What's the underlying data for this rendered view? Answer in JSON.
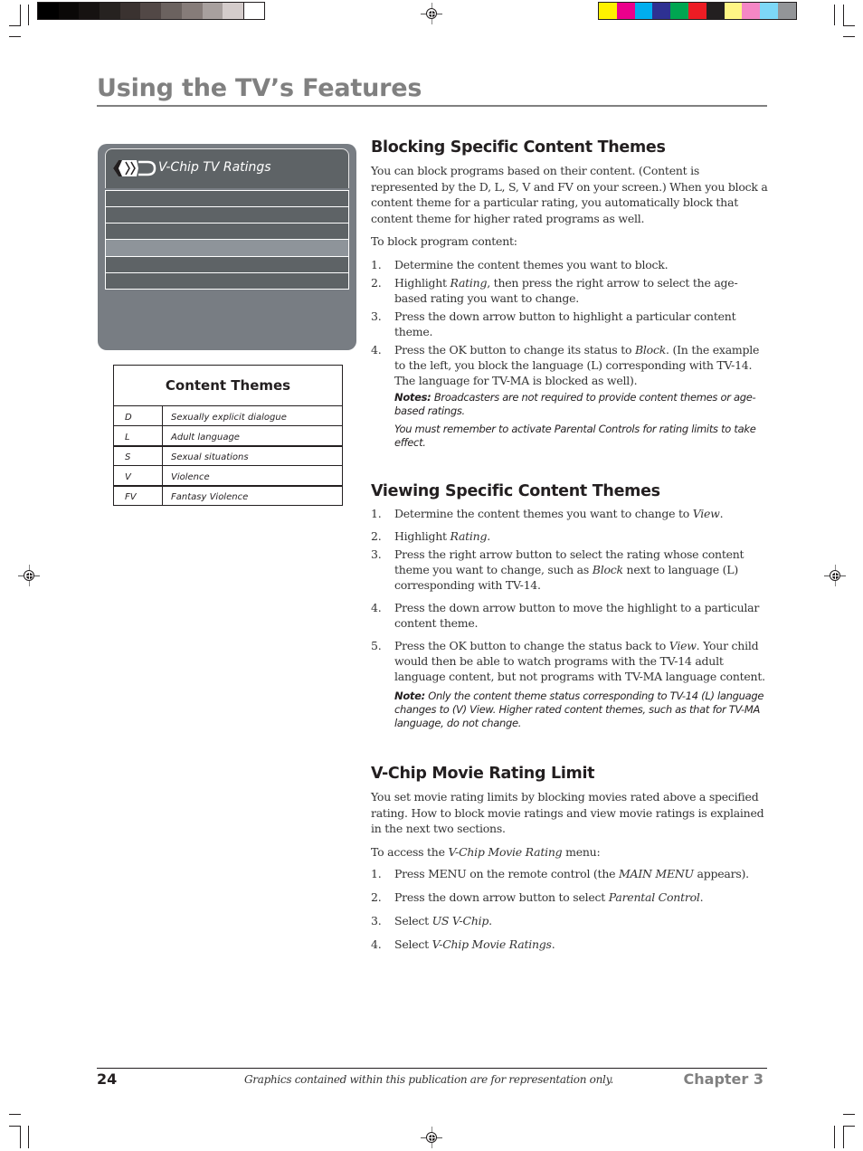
{
  "print_marks": {
    "grayscale_bars": [
      "#000000",
      "#0a0807",
      "#161211",
      "#262220",
      "#3a3230",
      "#524846",
      "#6b625f",
      "#867c79",
      "#a8a09e",
      "#d4cccb",
      "#ffffff"
    ],
    "color_bars": [
      "#fff200",
      "#ec008c",
      "#00aeef",
      "#2e3192",
      "#00a651",
      "#ed1c24",
      "#231f20",
      "#fff685",
      "#f587c5",
      "#7dd8f7",
      "#939598"
    ]
  },
  "header": {
    "title": "Using the TV’s Features"
  },
  "tv_menu": {
    "logo_icon": "v-chip-logo",
    "title": "V-Chip TV Ratings",
    "rows": [
      {
        "highlighted": false
      },
      {
        "highlighted": false
      },
      {
        "highlighted": false
      },
      {
        "highlighted": true
      },
      {
        "highlighted": false
      },
      {
        "highlighted": false
      }
    ],
    "colors": {
      "panel": "#787d83",
      "row": "#5e6366",
      "row_highlight": "#8e949a"
    }
  },
  "content_themes": {
    "title": "Content Themes",
    "rows": [
      {
        "code": "D",
        "description": "Sexually explicit dialogue"
      },
      {
        "code": "L",
        "description": "Adult language"
      },
      {
        "code": "S",
        "description": "Sexual situations"
      },
      {
        "code": "V",
        "description": "Violence"
      },
      {
        "code": "FV",
        "description": "Fantasy Violence"
      }
    ]
  },
  "blocking": {
    "heading": "Blocking Specific Content Themes",
    "intro": "You can block programs based on their content. (Content is represented by the D, L, S, V and FV on your screen.) When you block a content theme for a particular rating, you automatically block that content theme for higher rated programs as well.",
    "lead": "To block program content:",
    "steps": [
      {
        "num": "1.",
        "pre": "Determine the content themes you want to block.",
        "em": "",
        "post": ""
      },
      {
        "num": "2.",
        "pre": "Highlight ",
        "em": "Rating",
        "post": ", then press the right arrow to select the age-based rating you want to change."
      },
      {
        "num": "3.",
        "pre": "Press the down arrow button to highlight a particular content theme.",
        "em": "",
        "post": ""
      },
      {
        "num": "4.",
        "pre": "Press the OK button to change its status to ",
        "em": "Block",
        "post": ". (In the example to the left, you block the language (L) corresponding with TV-14. The language for TV-MA is blocked as well)."
      }
    ],
    "note_label": "Notes:",
    "note_1": " Broadcasters are not required to provide content themes or age-based ratings.",
    "note_2": "You must remember to activate Parental Controls for rating limits to take effect."
  },
  "viewing": {
    "heading": "Viewing Specific Content Themes",
    "steps": [
      {
        "num": "1.",
        "pre": "Determine the content themes you want to change to ",
        "em": "View",
        "post": "."
      },
      {
        "num": "2.",
        "pre": "Highlight ",
        "em": "Rating",
        "post": "."
      },
      {
        "num": "3.",
        "pre": "Press the right arrow button to select the rating whose content theme you want to change, such as ",
        "em": "Block",
        "post": " next to language (L) corresponding with TV-14."
      },
      {
        "num": "4.",
        "pre": "Press the down arrow button to move the highlight to a particular content theme.",
        "em": "",
        "post": ""
      },
      {
        "num": "5.",
        "pre": "Press the OK button to change the status back to ",
        "em": "View",
        "post": ".  Your child would then be able to watch programs with the TV-14 adult language content, but not programs with TV-MA language content."
      }
    ],
    "note_label": "Note:",
    "note": "  Only the content theme status corresponding to TV-14 (L) language changes to (V) View. Higher rated content themes, such as that for TV-MA language, do not change."
  },
  "movie": {
    "heading": "V-Chip Movie Rating Limit",
    "intro": "You set movie rating limits by blocking movies rated above a specified rating. How to block movie ratings and view movie ratings is explained in the next two sections.",
    "lead_pre": "To access the ",
    "lead_em": "V-Chip Movie Rating",
    "lead_post": " menu:",
    "steps": [
      {
        "num": "1.",
        "pre": "Press MENU on the remote control (the ",
        "em": "MAIN MENU",
        "post": " appears)."
      },
      {
        "num": "2.",
        "pre": "Press the down arrow button to select ",
        "em": "Parental Control",
        "post": "."
      },
      {
        "num": "3.",
        "pre": "Select ",
        "em": "US V-Chip",
        "post": "."
      },
      {
        "num": "4.",
        "pre": "Select ",
        "em": "V-Chip Movie Ratings",
        "post": "."
      }
    ]
  },
  "footer": {
    "page_number": "24",
    "disclaimer": "Graphics contained within this publication are for representation only.",
    "chapter": "Chapter 3"
  }
}
